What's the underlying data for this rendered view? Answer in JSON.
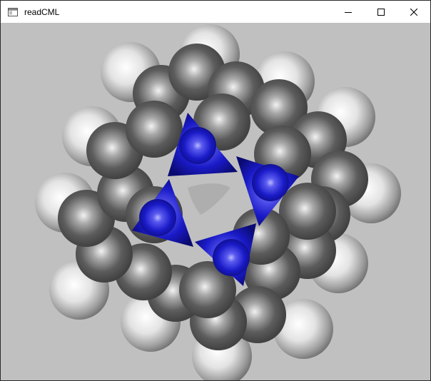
{
  "window": {
    "title": "readCML",
    "background": "#c0c0c0"
  },
  "controls": [
    "minimize-icon",
    "maximize-icon",
    "close-icon"
  ],
  "scene": {
    "type": "space-filling molecular model",
    "colors": {
      "carbon": "#555555",
      "hydrogen": "#e6e6e6",
      "nitrogen": "#1e1ecc"
    }
  }
}
